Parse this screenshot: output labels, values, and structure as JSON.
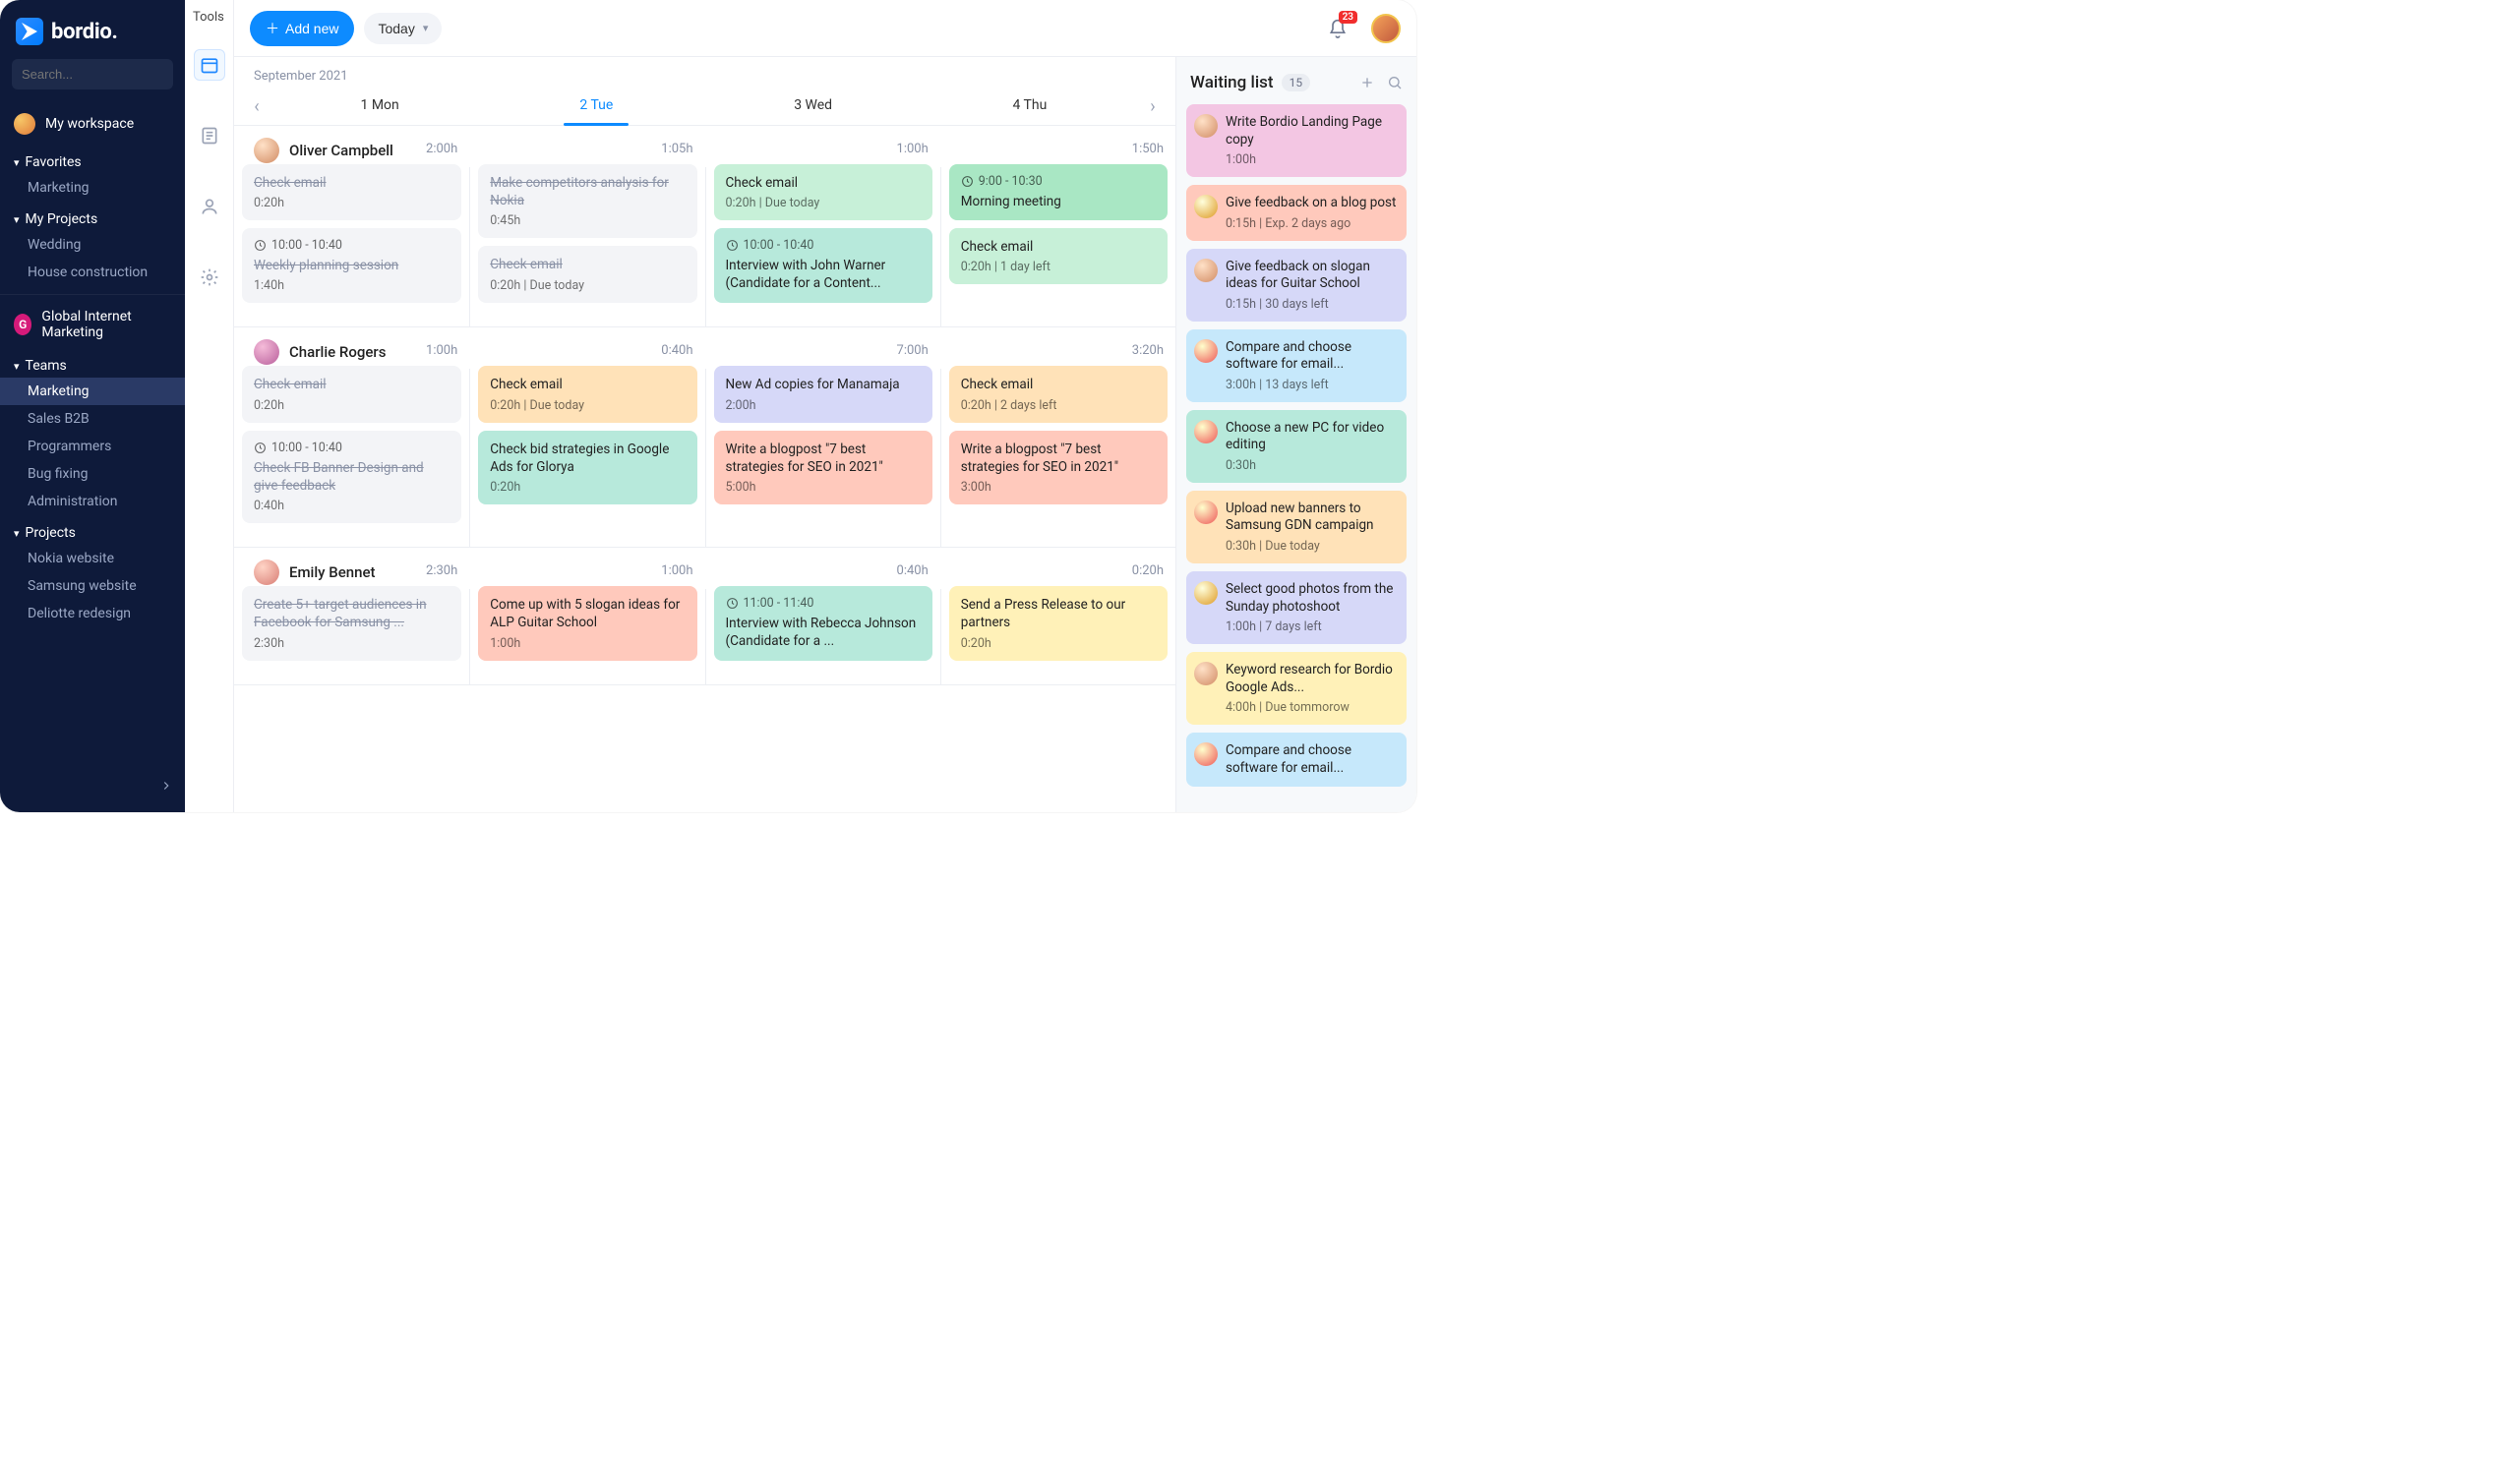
{
  "brand": "bordio.",
  "tools_label": "Tools",
  "search_placeholder": "Search...",
  "workspace": {
    "label": "My workspace"
  },
  "sidebar": {
    "favorites_label": "Favorites",
    "favorites": [
      "Marketing"
    ],
    "myprojects_label": "My Projects",
    "myprojects": [
      "Wedding",
      "House construction"
    ],
    "org_initial": "G",
    "org_name": "Global Internet Marketing",
    "teams_label": "Teams",
    "teams": [
      "Marketing",
      "Sales B2B",
      "Programmers",
      "Bug fixing",
      "Administration"
    ],
    "projects_label": "Projects",
    "projects": [
      "Nokia website",
      "Samsung website",
      "Deliotte redesign"
    ]
  },
  "toolbar": {
    "add": "Add new",
    "today": "Today"
  },
  "notifications": "23",
  "calendar": {
    "month": "September 2021",
    "days": [
      "1 Mon",
      "2 Tue",
      "3 Wed",
      "4 Thu"
    ],
    "active_index": 1
  },
  "people": [
    {
      "name": "Oliver Campbell",
      "avatar": "av1",
      "cols": [
        {
          "total": "2:00h",
          "cards": [
            {
              "title": "Check email",
              "meta": "0:20h",
              "cls": "done"
            },
            {
              "time": "10:00 - 10:40",
              "title": "Weekly planning session",
              "meta": "1:40h",
              "cls": "done"
            }
          ]
        },
        {
          "total": "1:05h",
          "cards": [
            {
              "title": "Make competitors analysis for Nokia",
              "meta": "0:45h",
              "cls": "done"
            },
            {
              "title": "Check email",
              "meta": "0:20h | Due today",
              "cls": "done"
            }
          ]
        },
        {
          "total": "1:00h",
          "cards": [
            {
              "title": "Check email",
              "meta": "0:20h | Due today",
              "cls": "c-green"
            },
            {
              "time": "10:00 - 10:40",
              "title": "Interview with John Warner (Candidate for a Content...",
              "cls": "c-teal"
            }
          ]
        },
        {
          "total": "1:50h",
          "cards": [
            {
              "time": "9:00 - 10:30",
              "title": "Morning meeting",
              "cls": "c-green-d"
            },
            {
              "title": "Check email",
              "meta": "0:20h | 1 day left",
              "cls": "c-green"
            }
          ]
        }
      ]
    },
    {
      "name": "Charlie Rogers",
      "avatar": "av2",
      "cols": [
        {
          "total": "1:00h",
          "cards": [
            {
              "title": "Check email",
              "meta": "0:20h",
              "cls": "done"
            },
            {
              "time": "10:00 - 10:40",
              "title": "Check FB Banner Design and give feedback",
              "meta": "0:40h",
              "cls": "done"
            }
          ]
        },
        {
          "total": "0:40h",
          "cards": [
            {
              "title": "Check email",
              "meta": "0:20h | Due today",
              "cls": "c-orange"
            },
            {
              "title": "Check bid strategies in Google Ads for Glorya",
              "meta": "0:20h",
              "cls": "c-teal"
            }
          ]
        },
        {
          "total": "7:00h",
          "cards": [
            {
              "title": "New Ad copies for Manamaja",
              "meta": "2:00h",
              "cls": "c-lav"
            },
            {
              "title": "Write a blogpost \"7 best strategies for SEO in 2021\"",
              "meta": "5:00h",
              "cls": "c-coral"
            }
          ]
        },
        {
          "total": "3:20h",
          "cards": [
            {
              "title": "Check email",
              "meta": "0:20h | 2 days left",
              "cls": "c-orange"
            },
            {
              "title": "Write a blogpost \"7 best strategies for SEO in 2021\"",
              "meta": "3:00h",
              "cls": "c-coral"
            }
          ]
        }
      ]
    },
    {
      "name": "Emily Bennet",
      "avatar": "av3",
      "cols": [
        {
          "total": "2:30h",
          "cards": [
            {
              "title": "Create 5+ target audiences in Facebook for Samsung ...",
              "meta": "2:30h",
              "cls": "done"
            }
          ]
        },
        {
          "total": "1:00h",
          "cards": [
            {
              "title": "Come up with 5 slogan ideas for ALP Guitar School",
              "meta": "1:00h",
              "cls": "c-coral"
            }
          ]
        },
        {
          "total": "0:40h",
          "cards": [
            {
              "time": "11:00 - 11:40",
              "title": "Interview with Rebecca Johnson (Candidate for a ...",
              "cls": "c-teal"
            }
          ]
        },
        {
          "total": "0:20h",
          "cards": [
            {
              "title": "Send a Press Release to our partners",
              "meta": "0:20h",
              "cls": "c-yellow"
            }
          ]
        }
      ]
    }
  ],
  "waiting": {
    "title": "Waiting list",
    "count": "15",
    "items": [
      {
        "title": "Write Bordio Landing Page copy",
        "meta": "1:00h",
        "cls": "c-pink",
        "av": "wa1"
      },
      {
        "title": "Give feedback on a blog post",
        "meta": "0:15h | Exp. 2 days ago",
        "cls": "c-coral",
        "av": "wa2"
      },
      {
        "title": "Give feedback on slogan ideas for Guitar School",
        "meta": "0:15h | 30 days left",
        "cls": "c-lav",
        "av": "wa1"
      },
      {
        "title": "Compare and choose software for email...",
        "meta": "3:00h | 13 days left",
        "cls": "c-blue",
        "av": "wa3"
      },
      {
        "title": "Choose a new PC for video editing",
        "meta": "0:30h",
        "cls": "c-teal",
        "av": "wa3"
      },
      {
        "title": "Upload new banners to Samsung GDN campaign",
        "meta": "0:30h | Due today",
        "cls": "c-orange",
        "av": "wa3"
      },
      {
        "title": "Select good photos from the Sunday photoshoot",
        "meta": "1:00h | 7 days left",
        "cls": "c-lav",
        "av": "wa2"
      },
      {
        "title": "Keyword research for Bordio Google Ads...",
        "meta": "4:00h | Due tommorow",
        "cls": "c-yellow",
        "av": "wa1"
      },
      {
        "title": "Compare and choose software for email...",
        "meta": "",
        "cls": "c-blue",
        "av": "wa3"
      }
    ]
  }
}
